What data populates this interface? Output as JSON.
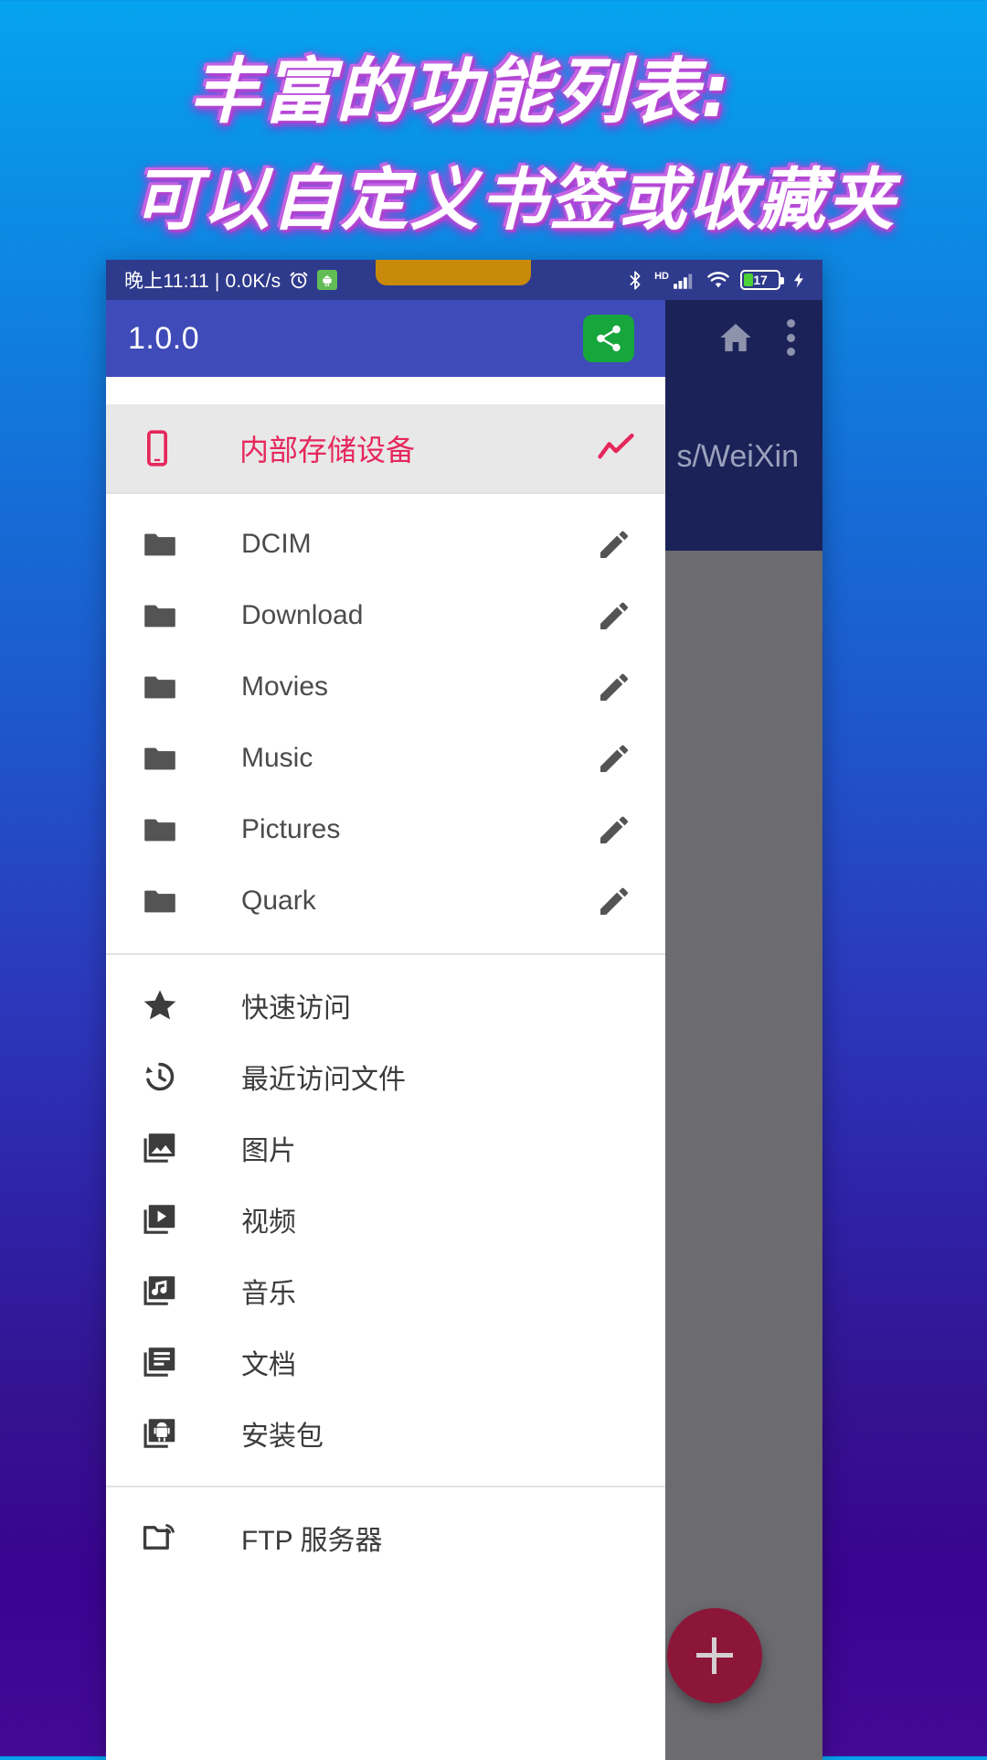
{
  "promo": {
    "line1": "丰富的功能列表:",
    "line2": "可以自定义书签或收藏夹"
  },
  "colors": {
    "bg_top": "#05A3EF",
    "bg_bottom": "#440A96",
    "appbar": "#3F4BB8",
    "statusbar": "#2E3A8C",
    "accent_pink": "#E6275C",
    "share_green": "#16A63C",
    "fab": "#8C1638",
    "scrim": "#6B6B70",
    "behind_panel": "#1B2257",
    "notch": "#C78A0A",
    "battery_fill": "#4CD137"
  },
  "statusbar": {
    "clock": "晚上11:11 | 0.0K/s",
    "alarm_icon": "alarm-clock-icon",
    "android_icon": "android-notification-icon",
    "bluetooth_icon": "bluetooth-icon",
    "hd_label": "HD",
    "signal_icon": "cellular-signal-icon",
    "wifi_icon": "wifi-icon",
    "battery_percent": "17",
    "charging_icon": "charging-bolt-icon"
  },
  "behind": {
    "home_icon": "home-icon",
    "overflow_icon": "overflow-menu-icon",
    "path": "s/WeiXin"
  },
  "appbar": {
    "version": "1.0.0",
    "share_icon": "share-icon"
  },
  "storage": {
    "icon": "smartphone-icon",
    "label": "内部存储设备",
    "trailing_icon": "trending-chart-icon"
  },
  "folders": [
    {
      "icon": "folder-icon",
      "label": "DCIM",
      "edit_icon": "pencil-edit-icon"
    },
    {
      "icon": "folder-icon",
      "label": "Download",
      "edit_icon": "pencil-edit-icon"
    },
    {
      "icon": "folder-icon",
      "label": "Movies",
      "edit_icon": "pencil-edit-icon"
    },
    {
      "icon": "folder-icon",
      "label": "Music",
      "edit_icon": "pencil-edit-icon"
    },
    {
      "icon": "folder-icon",
      "label": "Pictures",
      "edit_icon": "pencil-edit-icon"
    },
    {
      "icon": "folder-icon",
      "label": "Quark",
      "edit_icon": "pencil-edit-icon"
    }
  ],
  "functions": [
    {
      "icon": "star-icon",
      "label": "快速访问"
    },
    {
      "icon": "history-icon",
      "label": "最近访问文件"
    },
    {
      "icon": "photo-icon",
      "label": "图片"
    },
    {
      "icon": "video-icon",
      "label": "视频"
    },
    {
      "icon": "music-icon",
      "label": "音乐"
    },
    {
      "icon": "document-icon",
      "label": "文档"
    },
    {
      "icon": "apk-icon",
      "label": "安装包"
    }
  ],
  "services": [
    {
      "icon": "ftp-folder-icon",
      "label": "FTP 服务器"
    }
  ],
  "fab": {
    "icon": "plus-icon"
  }
}
